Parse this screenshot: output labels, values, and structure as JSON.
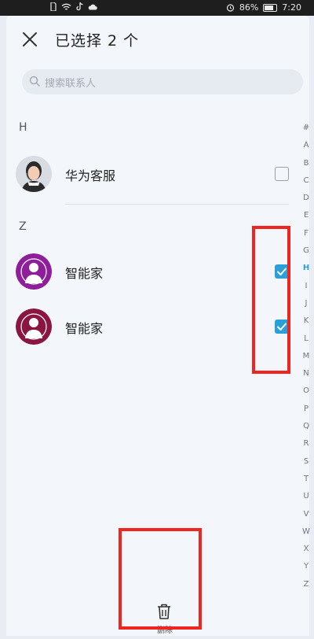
{
  "status_bar": {
    "battery": "86%",
    "time": "7:20"
  },
  "header": {
    "title": "已选择 2 个"
  },
  "search": {
    "placeholder": "搜索联系人"
  },
  "sections": [
    {
      "letter": "H",
      "contacts": [
        {
          "name": "华为客服",
          "checked": false
        }
      ]
    },
    {
      "letter": "Z",
      "contacts": [
        {
          "name": "智能家",
          "checked": true
        },
        {
          "name": "智能家",
          "checked": true
        }
      ]
    }
  ],
  "index_bar": {
    "letters": [
      "#",
      "A",
      "B",
      "C",
      "D",
      "E",
      "F",
      "G",
      "H",
      "I",
      "J",
      "K",
      "L",
      "M",
      "N",
      "O",
      "P",
      "Q",
      "R",
      "S",
      "T",
      "U",
      "V",
      "W",
      "X",
      "Y",
      "Z"
    ],
    "active": "H"
  },
  "bottom_bar": {
    "delete_label": "删除"
  },
  "colors": {
    "accent": "#2a9fd8",
    "highlight": "#f12520",
    "avatar_purple": "#8e1e9a",
    "avatar_maroon": "#8a1540"
  }
}
